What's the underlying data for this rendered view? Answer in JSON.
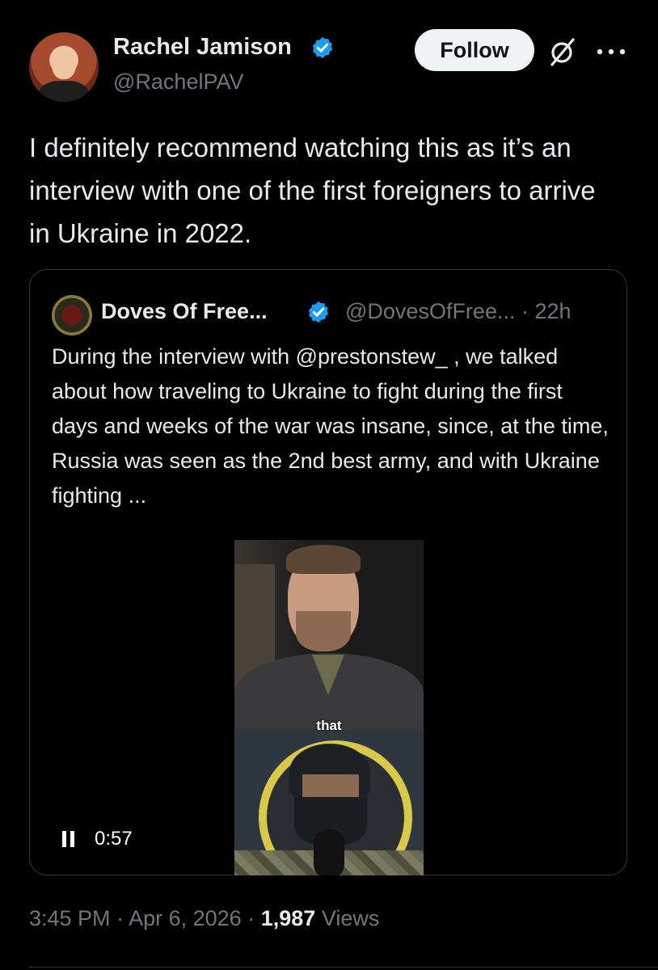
{
  "author": {
    "name": "Rachel Jamison",
    "handle": "@RachelPAV",
    "verified_color": "#1d9bf0"
  },
  "actions": {
    "follow_label": "Follow",
    "grok_icon": "grok-icon",
    "more_icon": "more-icon"
  },
  "tweet": {
    "text": "I definitely recommend watching this as it’s an interview with one of the first foreigners to arrive in Ukraine in 2022."
  },
  "quoted": {
    "name": "Doves Of Free...",
    "handle": "@DovesOfFree...",
    "separator": "·",
    "time": "22h",
    "text": "During the interview with @prestonstew_ , we talked about how traveling to Ukraine to fight during the first days and weeks of the war was insane, since, at the time, Russia was seen as the 2nd best army, and with Ukraine fighting ...",
    "video": {
      "caption": "that",
      "duration": "0:57",
      "state_icon": "pause-icon"
    }
  },
  "meta": {
    "time": "3:45 PM",
    "sep1": "·",
    "date": "Apr 6, 2026",
    "sep2": "·",
    "views_count": "1,987",
    "views_label": "Views"
  }
}
